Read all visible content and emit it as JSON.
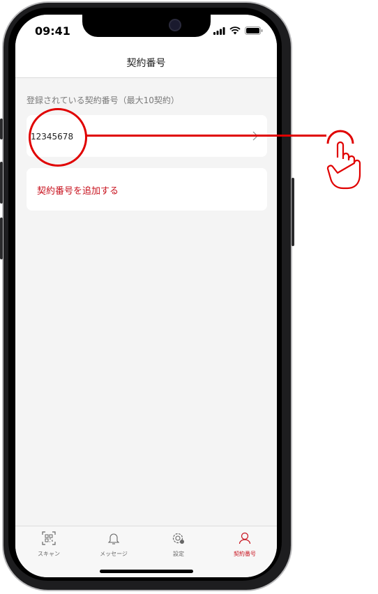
{
  "status": {
    "time": "09:41"
  },
  "nav": {
    "title": "契約番号"
  },
  "section": {
    "label": "登録されている契約番号（最大10契約）"
  },
  "contracts": [
    {
      "number": "12345678"
    }
  ],
  "add_contract": {
    "label": "契約番号を追加する"
  },
  "tabs": [
    {
      "label": "スキャン",
      "icon": "qr-scan-icon",
      "active": false
    },
    {
      "label": "メッセージ",
      "icon": "bell-icon",
      "active": false
    },
    {
      "label": "設定",
      "icon": "settings-icon",
      "active": false
    },
    {
      "label": "契約番号",
      "icon": "person-icon",
      "active": true
    }
  ],
  "colors": {
    "accent": "#c8121e",
    "annotation": "#e00000",
    "background": "#f4f4f4"
  }
}
